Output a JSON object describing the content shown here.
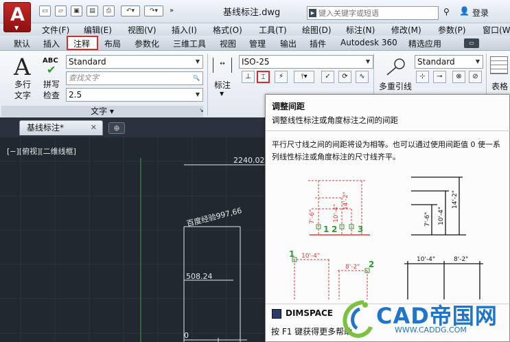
{
  "app": {
    "icon": "autocad-logo",
    "doc_title": "基线标注.dwg"
  },
  "search": {
    "placeholder": "键入关键字或短语"
  },
  "user": {
    "login": "登录"
  },
  "menus": [
    "文件(F)",
    "编辑(E)",
    "视图(V)",
    "插入(I)",
    "格式(O)",
    "工具(T)",
    "绘图(D)",
    "标注(N)",
    "修改(M)",
    "参数(P)",
    "窗口(W"
  ],
  "tabs": [
    "默认",
    "插入",
    "注释",
    "布局",
    "参数化",
    "三维工具",
    "视图",
    "管理",
    "输出",
    "插件",
    "Autodesk 360",
    "精选应用"
  ],
  "active_tab": "注释",
  "ribbon": {
    "text_panel": {
      "mtext_label_1": "多行",
      "mtext_label_2": "文字",
      "spell_label_1": "拼写",
      "spell_label_2": "检查",
      "abc": "ABC",
      "style": "Standard",
      "find_placeholder": "查找文字",
      "height": "2.5",
      "title": "文字"
    },
    "dim_panel": {
      "label": "标注",
      "style": "ISO-25"
    },
    "leader_panel": {
      "label": "多重引线",
      "style": "Standard"
    },
    "table_panel": {
      "label": "表格"
    }
  },
  "file_tab": {
    "name": "基线标注*"
  },
  "canvas": {
    "viewport_label": "[−][俯视][二维线框]",
    "dims": [
      "2240.02",
      "百度经验997,66",
      "508.24",
      "0"
    ]
  },
  "tooltip": {
    "title": "调整间距",
    "description": "调整线性标注或角度标注之间的间距",
    "detail": "平行尺寸线之间的间距将设为相等。也可以通过使用间距值 0 使一系列线性标注或角度标注的尺寸线齐平。",
    "figure_labels": {
      "top_left": [
        "7'-6\"",
        "10'-4\"",
        "14'-2\"",
        "1",
        "2",
        "3"
      ],
      "top_right": [
        "7'-6\"",
        "10'-4\"",
        "14'-2\""
      ],
      "bottom_left": [
        "10'-4\"",
        "8'-2\"",
        "1",
        "2"
      ],
      "bottom_right": [
        "10'-4\"",
        "8'-2\""
      ]
    },
    "command": "DIMSPACE",
    "help": "按 F1 键获得更多帮助"
  },
  "watermark": {
    "text": "CAD帝国网",
    "url": "WWW.CADDG.COM"
  },
  "colors": {
    "accent_red": "#d32f2f",
    "watermark_blue": "#1e75c9",
    "fig_red": "#e53935",
    "fig_green": "#2e9b2e"
  }
}
